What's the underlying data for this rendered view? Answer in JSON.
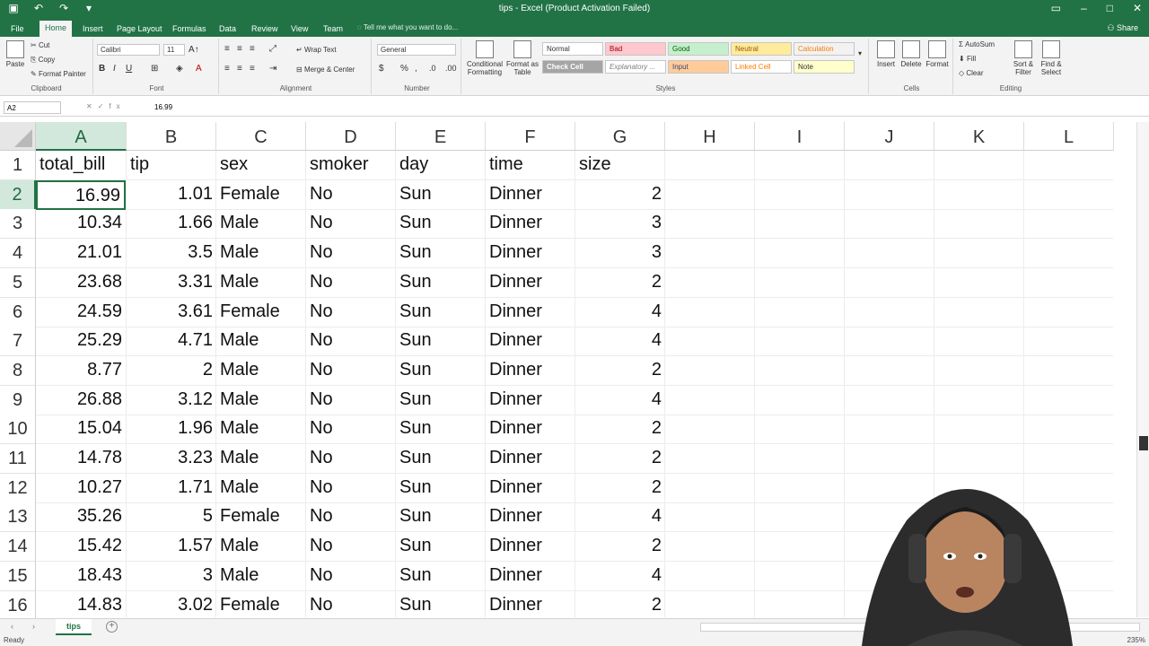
{
  "window": {
    "title": "tips - Excel (Product Activation Failed)",
    "share_label": "Share",
    "tell_me": "Tell me what you want to do..."
  },
  "tabs": [
    "File",
    "Home",
    "Insert",
    "Page Layout",
    "Formulas",
    "Data",
    "Review",
    "View",
    "Team"
  ],
  "ribbon": {
    "clipboard": {
      "paste": "Paste",
      "cut": "Cut",
      "copy": "Copy",
      "format_painter": "Format Painter",
      "label": "Clipboard"
    },
    "font": {
      "name": "Calibri",
      "size": "11",
      "label": "Font"
    },
    "alignment": {
      "wrap": "Wrap Text",
      "merge": "Merge & Center",
      "label": "Alignment"
    },
    "number": {
      "format": "General",
      "label": "Number"
    },
    "styles": {
      "conditional": "Conditional Formatting",
      "format_table": "Format as Table",
      "cells": [
        "Normal",
        "Bad",
        "Good",
        "Neutral",
        "Calculation",
        "Check Cell",
        "Explanatory ...",
        "Input",
        "Linked Cell",
        "Note"
      ],
      "label": "Styles"
    },
    "cells": {
      "insert": "Insert",
      "delete": "Delete",
      "format": "Format",
      "label": "Cells"
    },
    "editing": {
      "autosum": "AutoSum",
      "fill": "Fill",
      "clear": "Clear",
      "sort": "Sort & Filter",
      "find": "Find & Select",
      "label": "Editing"
    }
  },
  "formula_bar": {
    "name_box": "A2",
    "fx": "fx",
    "value": "16.99"
  },
  "columns": [
    "A",
    "B",
    "C",
    "D",
    "E",
    "F",
    "G",
    "H",
    "I",
    "J",
    "K",
    "L"
  ],
  "rows": [
    "1",
    "2",
    "3",
    "4",
    "5",
    "6",
    "7",
    "8",
    "9",
    "10",
    "11",
    "12",
    "13",
    "14",
    "15",
    "16"
  ],
  "table": {
    "headers": [
      "total_bill",
      "tip",
      "sex",
      "smoker",
      "day",
      "time",
      "size"
    ],
    "data": [
      [
        "16.99",
        "1.01",
        "Female",
        "No",
        "Sun",
        "Dinner",
        "2"
      ],
      [
        "10.34",
        "1.66",
        "Male",
        "No",
        "Sun",
        "Dinner",
        "3"
      ],
      [
        "21.01",
        "3.5",
        "Male",
        "No",
        "Sun",
        "Dinner",
        "3"
      ],
      [
        "23.68",
        "3.31",
        "Male",
        "No",
        "Sun",
        "Dinner",
        "2"
      ],
      [
        "24.59",
        "3.61",
        "Female",
        "No",
        "Sun",
        "Dinner",
        "4"
      ],
      [
        "25.29",
        "4.71",
        "Male",
        "No",
        "Sun",
        "Dinner",
        "4"
      ],
      [
        "8.77",
        "2",
        "Male",
        "No",
        "Sun",
        "Dinner",
        "2"
      ],
      [
        "26.88",
        "3.12",
        "Male",
        "No",
        "Sun",
        "Dinner",
        "4"
      ],
      [
        "15.04",
        "1.96",
        "Male",
        "No",
        "Sun",
        "Dinner",
        "2"
      ],
      [
        "14.78",
        "3.23",
        "Male",
        "No",
        "Sun",
        "Dinner",
        "2"
      ],
      [
        "10.27",
        "1.71",
        "Male",
        "No",
        "Sun",
        "Dinner",
        "2"
      ],
      [
        "35.26",
        "5",
        "Female",
        "No",
        "Sun",
        "Dinner",
        "4"
      ],
      [
        "15.42",
        "1.57",
        "Male",
        "No",
        "Sun",
        "Dinner",
        "2"
      ],
      [
        "18.43",
        "3",
        "Male",
        "No",
        "Sun",
        "Dinner",
        "4"
      ],
      [
        "14.83",
        "3.02",
        "Female",
        "No",
        "Sun",
        "Dinner",
        "2"
      ]
    ]
  },
  "sheet_tab": "tips",
  "status": "Ready",
  "zoom": "235%",
  "colors": {
    "accent": "#217346"
  }
}
